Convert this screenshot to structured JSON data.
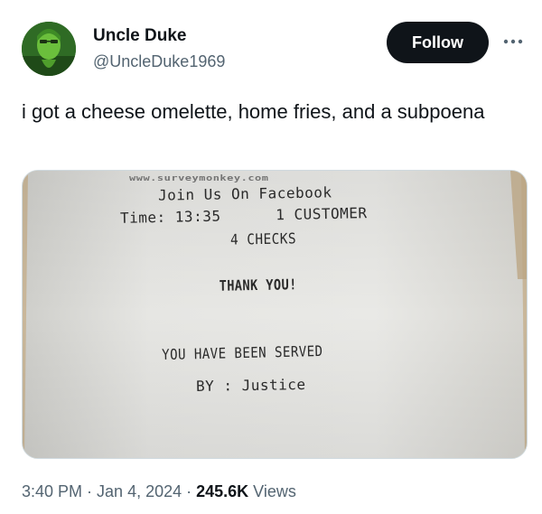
{
  "author": {
    "name": "Uncle Duke",
    "handle": "@UncleDuke1969"
  },
  "actions": {
    "follow_label": "Follow",
    "more_icon": "more-options-icon"
  },
  "tweet": {
    "text": "i got a cheese omelette, home fries, and a subpoena"
  },
  "receipt": {
    "url_line": "www.surveymonkey.com",
    "join_line": "Join Us On Facebook",
    "time_line": "Time: 13:35      1 CUSTOMER",
    "checks_line": "4 CHECKS",
    "thanks_line": "THANK YOU!",
    "served_line": "YOU HAVE BEEN SERVED",
    "justice_line": "BY : Justice"
  },
  "meta": {
    "time": "3:40 PM",
    "sep1": " · ",
    "date": "Jan 4, 2024",
    "sep2": " · ",
    "views_count": "245.6K",
    "views_label": " Views"
  }
}
